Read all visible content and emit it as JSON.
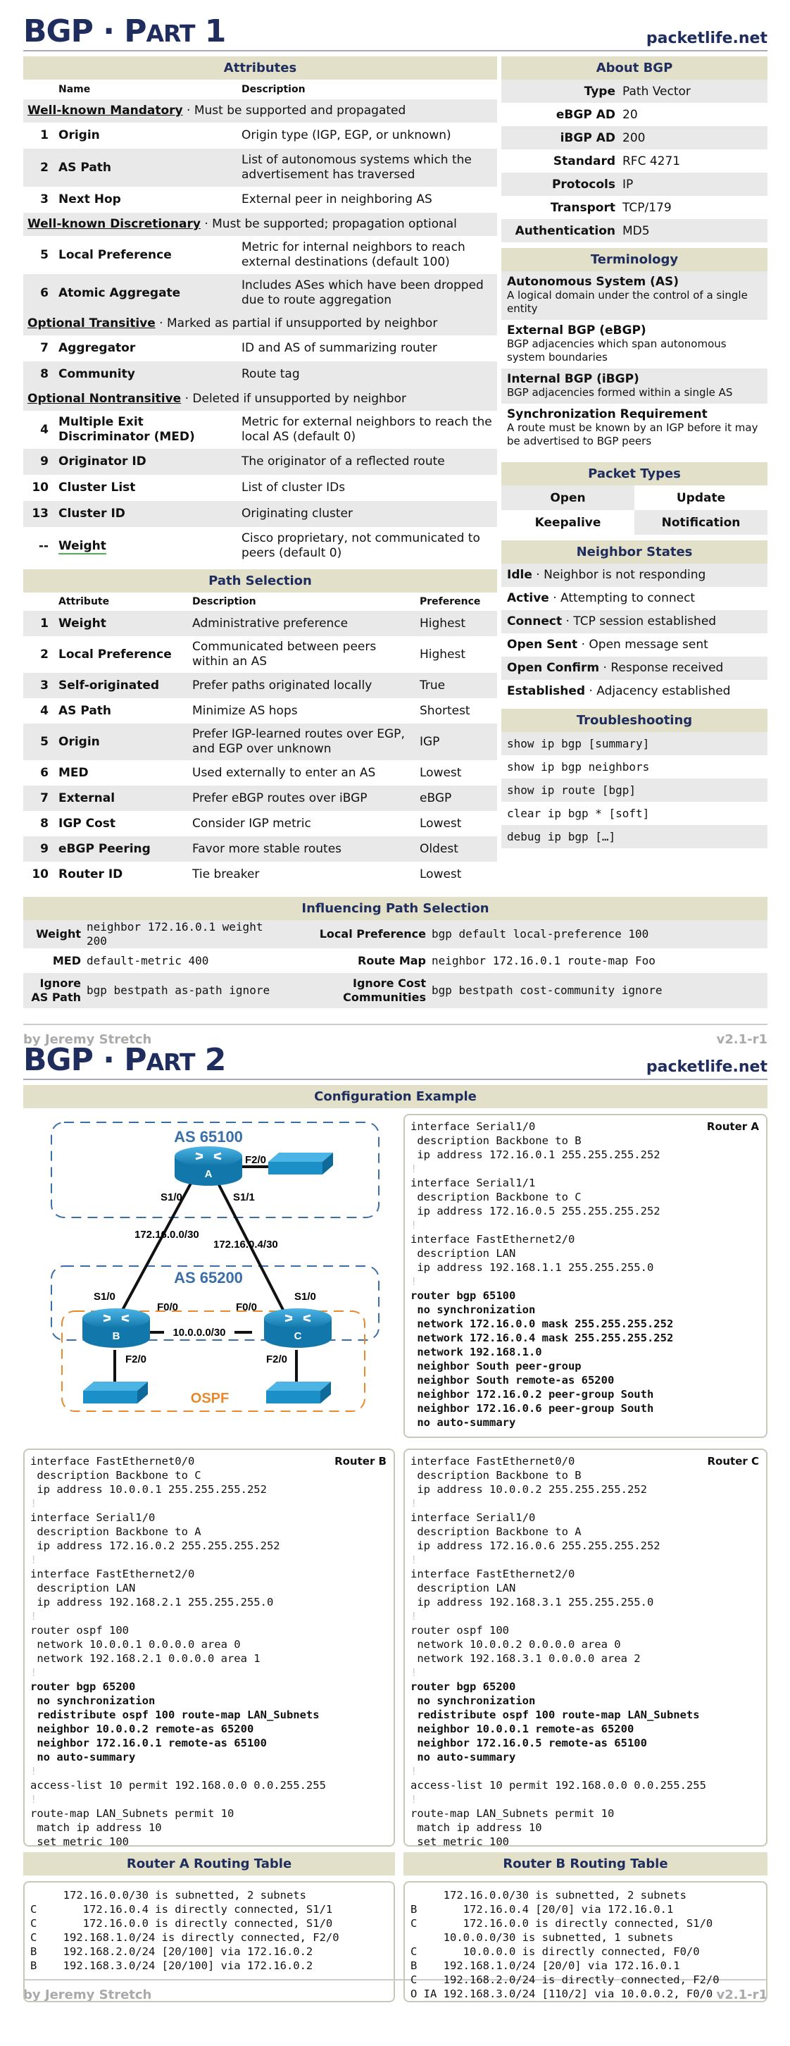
{
  "part1": {
    "title_main": "BGP · P",
    "title_sc": "ART",
    "title_num": " 1",
    "site": "packetlife.net",
    "attributes": {
      "heading": "Attributes",
      "col_name": "Name",
      "col_desc": "Description",
      "groups": [
        {
          "cat": "Well-known Mandatory",
          "cat_desc": " · Must be supported and propagated",
          "rows": [
            {
              "num": "1",
              "name": "Origin",
              "desc": "Origin type (IGP, EGP, or unknown)"
            },
            {
              "num": "2",
              "name": "AS Path",
              "desc": "List of autonomous systems which the advertisement has traversed"
            },
            {
              "num": "3",
              "name": "Next Hop",
              "desc": "External peer in neighboring AS"
            }
          ]
        },
        {
          "cat": "Well-known Discretionary",
          "cat_desc": " · Must be supported; propagation optional",
          "rows": [
            {
              "num": "5",
              "name": "Local Preference",
              "desc": "Metric for internal neighbors to reach external destinations (default 100)"
            },
            {
              "num": "6",
              "name": "Atomic Aggregate",
              "desc": "Includes ASes which have been dropped due to route aggregation"
            }
          ]
        },
        {
          "cat": "Optional Transitive",
          "cat_desc": " · Marked as partial if unsupported by neighbor",
          "rows": [
            {
              "num": "7",
              "name": "Aggregator",
              "desc": "ID and AS of summarizing router"
            },
            {
              "num": "8",
              "name": "Community",
              "desc": "Route tag"
            }
          ]
        },
        {
          "cat": "Optional Nontransitive",
          "cat_desc": " · Deleted if unsupported by neighbor",
          "rows": [
            {
              "num": "4",
              "name": "Multiple Exit Discriminator (MED)",
              "desc": "Metric for external neighbors to reach the local AS (default 0)"
            },
            {
              "num": "9",
              "name": "Originator ID",
              "desc": "The originator of a reflected route"
            },
            {
              "num": "10",
              "name": "Cluster List",
              "desc": "List of cluster IDs"
            },
            {
              "num": "13",
              "name": "Cluster ID",
              "desc": "Originating cluster"
            },
            {
              "num": "--",
              "name": "Weight",
              "desc": "Cisco proprietary, not communicated to peers (default 0)"
            }
          ]
        }
      ]
    },
    "about": {
      "heading": "About BGP",
      "rows": [
        {
          "k": "Type",
          "v": "Path Vector"
        },
        {
          "k": "eBGP AD",
          "v": "20"
        },
        {
          "k": "iBGP AD",
          "v": "200"
        },
        {
          "k": "Standard",
          "v": "RFC 4271"
        },
        {
          "k": "Protocols",
          "v": "IP"
        },
        {
          "k": "Transport",
          "v": "TCP/179"
        },
        {
          "k": "Authentication",
          "v": "MD5"
        }
      ]
    },
    "terminology": {
      "heading": "Terminology",
      "items": [
        {
          "term": "Autonomous System (AS)",
          "def": "A logical domain under the control of a single entity"
        },
        {
          "term": "External BGP (eBGP)",
          "def": "BGP adjacencies which span autonomous system boundaries"
        },
        {
          "term": "Internal BGP (iBGP)",
          "def": "BGP adjacencies formed within a single AS"
        },
        {
          "term": "Synchronization Requirement",
          "def": "A route must be known by an IGP before it may be advertised to BGP peers"
        }
      ]
    },
    "packet_types": {
      "heading": "Packet Types",
      "items": [
        "Open",
        "Update",
        "Keepalive",
        "Notification"
      ]
    },
    "neighbor_states": {
      "heading": "Neighbor States",
      "items": [
        {
          "state": "Idle",
          "desc": " · Neighbor is not responding"
        },
        {
          "state": "Active",
          "desc": " · Attempting to connect"
        },
        {
          "state": "Connect",
          "desc": " · TCP session established"
        },
        {
          "state": "Open Sent",
          "desc": " · Open message sent"
        },
        {
          "state": "Open Confirm",
          "desc": " · Response received"
        },
        {
          "state": "Established",
          "desc": " · Adjacency established"
        }
      ]
    },
    "troubleshooting": {
      "heading": "Troubleshooting",
      "commands": [
        "show ip bgp [summary]",
        "show ip bgp neighbors",
        "show ip route [bgp]",
        "clear ip bgp * [soft]",
        "debug ip bgp […]"
      ]
    },
    "path_selection": {
      "heading": "Path Selection",
      "col_attr": "Attribute",
      "col_desc": "Description",
      "col_pref": "Preference",
      "rows": [
        {
          "num": "1",
          "attr": "Weight",
          "desc": "Administrative preference",
          "pref": "Highest"
        },
        {
          "num": "2",
          "attr": "Local Preference",
          "desc": "Communicated between peers within an AS",
          "pref": "Highest"
        },
        {
          "num": "3",
          "attr": "Self-originated",
          "desc": "Prefer paths originated locally",
          "pref": "True"
        },
        {
          "num": "4",
          "attr": "AS Path",
          "desc": "Minimize AS hops",
          "pref": "Shortest"
        },
        {
          "num": "5",
          "attr": "Origin",
          "desc": "Prefer IGP-learned routes over EGP, and EGP over unknown",
          "pref": "IGP"
        },
        {
          "num": "6",
          "attr": "MED",
          "desc": "Used externally to enter an AS",
          "pref": "Lowest"
        },
        {
          "num": "7",
          "attr": "External",
          "desc": "Prefer eBGP routes over iBGP",
          "pref": "eBGP"
        },
        {
          "num": "8",
          "attr": "IGP Cost",
          "desc": "Consider IGP metric",
          "pref": "Lowest"
        },
        {
          "num": "9",
          "attr": "eBGP Peering",
          "desc": "Favor more stable routes",
          "pref": "Oldest"
        },
        {
          "num": "10",
          "attr": "Router ID",
          "desc": "Tie breaker",
          "pref": "Lowest"
        }
      ]
    },
    "influencing": {
      "heading": "Influencing Path Selection",
      "rows": [
        [
          {
            "k": "Weight",
            "v": "neighbor 172.16.0.1 weight 200"
          },
          {
            "k": "Local Preference",
            "v": "bgp default local-preference 100"
          }
        ],
        [
          {
            "k": "MED",
            "v": "default-metric 400"
          },
          {
            "k": "Route Map",
            "v": "neighbor 172.16.0.1 route-map Foo"
          }
        ],
        [
          {
            "k": "Ignore AS Path",
            "v": "bgp bestpath as-path ignore"
          },
          {
            "k": "Ignore Cost Communities",
            "v": "bgp bestpath cost-community ignore"
          }
        ]
      ]
    },
    "author": "by Jeremy Stretch",
    "version": "v2.1-r1"
  },
  "part2": {
    "title_main": "BGP · P",
    "title_sc": "ART",
    "title_num": " 2",
    "site": "packetlife.net",
    "config_heading": "Configuration Example",
    "diagram": {
      "as_top": "AS 65100",
      "as_bottom": "AS 65200",
      "ospf": "OSPF",
      "router_a": "A",
      "router_b": "B",
      "router_c": "C",
      "a_f20": "F2/0",
      "a_s10": "S1/0",
      "a_s11": "S1/1",
      "net_ab": "172.16.0.0/30",
      "net_ac": "172.16.0.4/30",
      "b_s10": "S1/0",
      "c_s10": "S1/0",
      "b_f00": "F0/0",
      "c_f00": "F0/0",
      "net_bc": "10.0.0.0/30",
      "b_f20": "F2/0",
      "c_f20": "F2/0"
    },
    "router_a": {
      "label": "Router A",
      "lines": [
        {
          "t": "interface Serial1/0"
        },
        {
          "t": " description Backbone to B"
        },
        {
          "t": " ip address 172.16.0.1 255.255.255.252"
        },
        {
          "t": "!",
          "bang": true
        },
        {
          "t": "interface Serial1/1"
        },
        {
          "t": " description Backbone to C"
        },
        {
          "t": " ip address 172.16.0.5 255.255.255.252"
        },
        {
          "t": "!",
          "bang": true
        },
        {
          "t": "interface FastEthernet2/0"
        },
        {
          "t": " description LAN"
        },
        {
          "t": " ip address 192.168.1.1 255.255.255.0"
        },
        {
          "t": "!",
          "bang": true
        },
        {
          "t": "router bgp 65100",
          "b": true
        },
        {
          "t": " no synchronization",
          "b": true
        },
        {
          "t": " network 172.16.0.0 mask 255.255.255.252",
          "b": true
        },
        {
          "t": " network 172.16.0.4 mask 255.255.255.252",
          "b": true
        },
        {
          "t": " network 192.168.1.0",
          "b": true
        },
        {
          "t": " neighbor South peer-group",
          "b": true
        },
        {
          "t": " neighbor South remote-as 65200",
          "b": true
        },
        {
          "t": " neighbor 172.16.0.2 peer-group South",
          "b": true
        },
        {
          "t": " neighbor 172.16.0.6 peer-group South",
          "b": true
        },
        {
          "t": " no auto-summary",
          "b": true
        }
      ]
    },
    "router_b": {
      "label": "Router B",
      "lines": [
        {
          "t": "interface FastEthernet0/0"
        },
        {
          "t": " description Backbone to C"
        },
        {
          "t": " ip address 10.0.0.1 255.255.255.252"
        },
        {
          "t": "!",
          "bang": true
        },
        {
          "t": "interface Serial1/0"
        },
        {
          "t": " description Backbone to A"
        },
        {
          "t": " ip address 172.16.0.2 255.255.255.252"
        },
        {
          "t": "!",
          "bang": true
        },
        {
          "t": "interface FastEthernet2/0"
        },
        {
          "t": " description LAN"
        },
        {
          "t": " ip address 192.168.2.1 255.255.255.0"
        },
        {
          "t": "!",
          "bang": true
        },
        {
          "t": "router ospf 100"
        },
        {
          "t": " network 10.0.0.1 0.0.0.0 area 0"
        },
        {
          "t": " network 192.168.2.1 0.0.0.0 area 1"
        },
        {
          "t": "!",
          "bang": true
        },
        {
          "t": "router bgp 65200",
          "b": true
        },
        {
          "t": " no synchronization",
          "b": true
        },
        {
          "t": " redistribute ospf 100 route-map LAN_Subnets",
          "b": true
        },
        {
          "t": " neighbor 10.0.0.2 remote-as 65200",
          "b": true
        },
        {
          "t": " neighbor 172.16.0.1 remote-as 65100",
          "b": true
        },
        {
          "t": " no auto-summary",
          "b": true
        },
        {
          "t": "!",
          "bang": true
        },
        {
          "t": "access-list 10 permit 192.168.0.0 0.0.255.255"
        },
        {
          "t": "!",
          "bang": true
        },
        {
          "t": "route-map LAN_Subnets permit 10"
        },
        {
          "t": " match ip address 10"
        },
        {
          "t": " set metric 100"
        }
      ]
    },
    "router_c": {
      "label": "Router C",
      "lines": [
        {
          "t": "interface FastEthernet0/0"
        },
        {
          "t": " description Backbone to B"
        },
        {
          "t": " ip address 10.0.0.2 255.255.255.252"
        },
        {
          "t": "!",
          "bang": true
        },
        {
          "t": "interface Serial1/0"
        },
        {
          "t": " description Backbone to A"
        },
        {
          "t": " ip address 172.16.0.6 255.255.255.252"
        },
        {
          "t": "!",
          "bang": true
        },
        {
          "t": "interface FastEthernet2/0"
        },
        {
          "t": " description LAN"
        },
        {
          "t": " ip address 192.168.3.1 255.255.255.0"
        },
        {
          "t": "!",
          "bang": true
        },
        {
          "t": "router ospf 100"
        },
        {
          "t": " network 10.0.0.2 0.0.0.0 area 0"
        },
        {
          "t": " network 192.168.3.1 0.0.0.0 area 2"
        },
        {
          "t": "!",
          "bang": true
        },
        {
          "t": "router bgp 65200",
          "b": true
        },
        {
          "t": " no synchronization",
          "b": true
        },
        {
          "t": " redistribute ospf 100 route-map LAN_Subnets",
          "b": true
        },
        {
          "t": " neighbor 10.0.0.1 remote-as 65200",
          "b": true
        },
        {
          "t": " neighbor 172.16.0.5 remote-as 65100",
          "b": true
        },
        {
          "t": " no auto-summary",
          "b": true
        },
        {
          "t": "!",
          "bang": true
        },
        {
          "t": "access-list 10 permit 192.168.0.0 0.0.255.255"
        },
        {
          "t": "!",
          "bang": true
        },
        {
          "t": "route-map LAN_Subnets permit 10"
        },
        {
          "t": " match ip address 10"
        },
        {
          "t": " set metric 100"
        }
      ]
    },
    "rt_a": {
      "heading": "Router A Routing Table",
      "lines": [
        "     172.16.0.0/30 is subnetted, 2 subnets",
        "C       172.16.0.4 is directly connected, S1/1",
        "C       172.16.0.0 is directly connected, S1/0",
        "C    192.168.1.0/24 is directly connected, F2/0",
        "B    192.168.2.0/24 [20/100] via 172.16.0.2",
        "B    192.168.3.0/24 [20/100] via 172.16.0.2"
      ]
    },
    "rt_b": {
      "heading": "Router B Routing Table",
      "lines": [
        "     172.16.0.0/30 is subnetted, 2 subnets",
        "B       172.16.0.4 [20/0] via 172.16.0.1",
        "C       172.16.0.0 is directly connected, S1/0",
        "     10.0.0.0/30 is subnetted, 1 subnets",
        "C       10.0.0.0 is directly connected, F0/0",
        "B    192.168.1.0/24 [20/0] via 172.16.0.1",
        "C    192.168.2.0/24 is directly connected, F2/0",
        "O IA 192.168.3.0/24 [110/2] via 10.0.0.2, F0/0"
      ]
    },
    "author": "by Jeremy Stretch",
    "version": "v2.1-r1"
  },
  "colors": {
    "title": "#1e2d5e",
    "section_header_bg": "#e2e0c8",
    "row_grey": "#e9e9e9",
    "as_border": "#3a6ea8",
    "ospf_border": "#e8892e",
    "router_blue": "#1b8fc7"
  }
}
